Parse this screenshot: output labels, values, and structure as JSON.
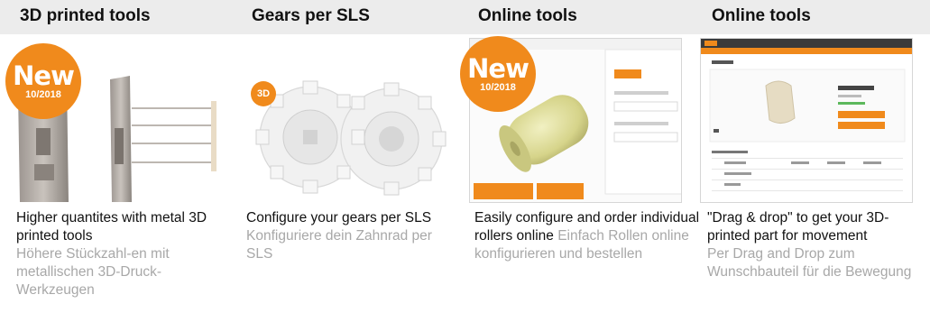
{
  "columns": [
    {
      "title": "3D printed tools",
      "badge": {
        "label": "New",
        "date": "10/2018"
      },
      "desc_en": "Higher quantites with metal 3D printed tools",
      "desc_de": "Höhere Stückzahl-en mit metallischen 3D-Druck-Werkzeugen"
    },
    {
      "title": "Gears per SLS",
      "logo": "3D",
      "desc_en": "Configure your gears per SLS",
      "desc_de": "Konfiguriere dein Zahnrad per SLS"
    },
    {
      "title": "Online tools",
      "badge": {
        "label": "New",
        "date": "10/2018"
      },
      "desc_en": "Easily configure and order individual rollers online",
      "desc_de": "Einfach Rollen online konfigurieren und bestellen"
    },
    {
      "title": "Online tools",
      "desc_en": "\"Drag & drop\" to get your 3D-printed part for movement",
      "desc_de": "Per Drag and Drop zum Wunschbauteil für die Bewegung"
    }
  ],
  "colors": {
    "accent": "#f08a1c",
    "header_bg": "#ececec",
    "secondary_text": "#a8a8a8"
  }
}
